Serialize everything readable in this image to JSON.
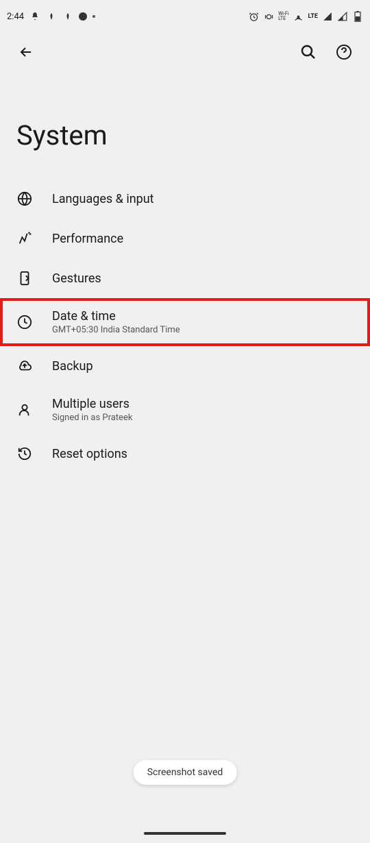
{
  "statusBar": {
    "time": "2:44",
    "lte": "LTE",
    "wifiLabel": "Wi-Fi\nLTE"
  },
  "pageTitle": "System",
  "items": [
    {
      "label": "Languages & input",
      "sub": ""
    },
    {
      "label": "Performance",
      "sub": ""
    },
    {
      "label": "Gestures",
      "sub": ""
    },
    {
      "label": "Date & time",
      "sub": "GMT+05:30 India Standard Time"
    },
    {
      "label": "Backup",
      "sub": ""
    },
    {
      "label": "Multiple users",
      "sub": "Signed in as Prateek"
    },
    {
      "label": "Reset options",
      "sub": ""
    }
  ],
  "toast": "Screenshot saved"
}
